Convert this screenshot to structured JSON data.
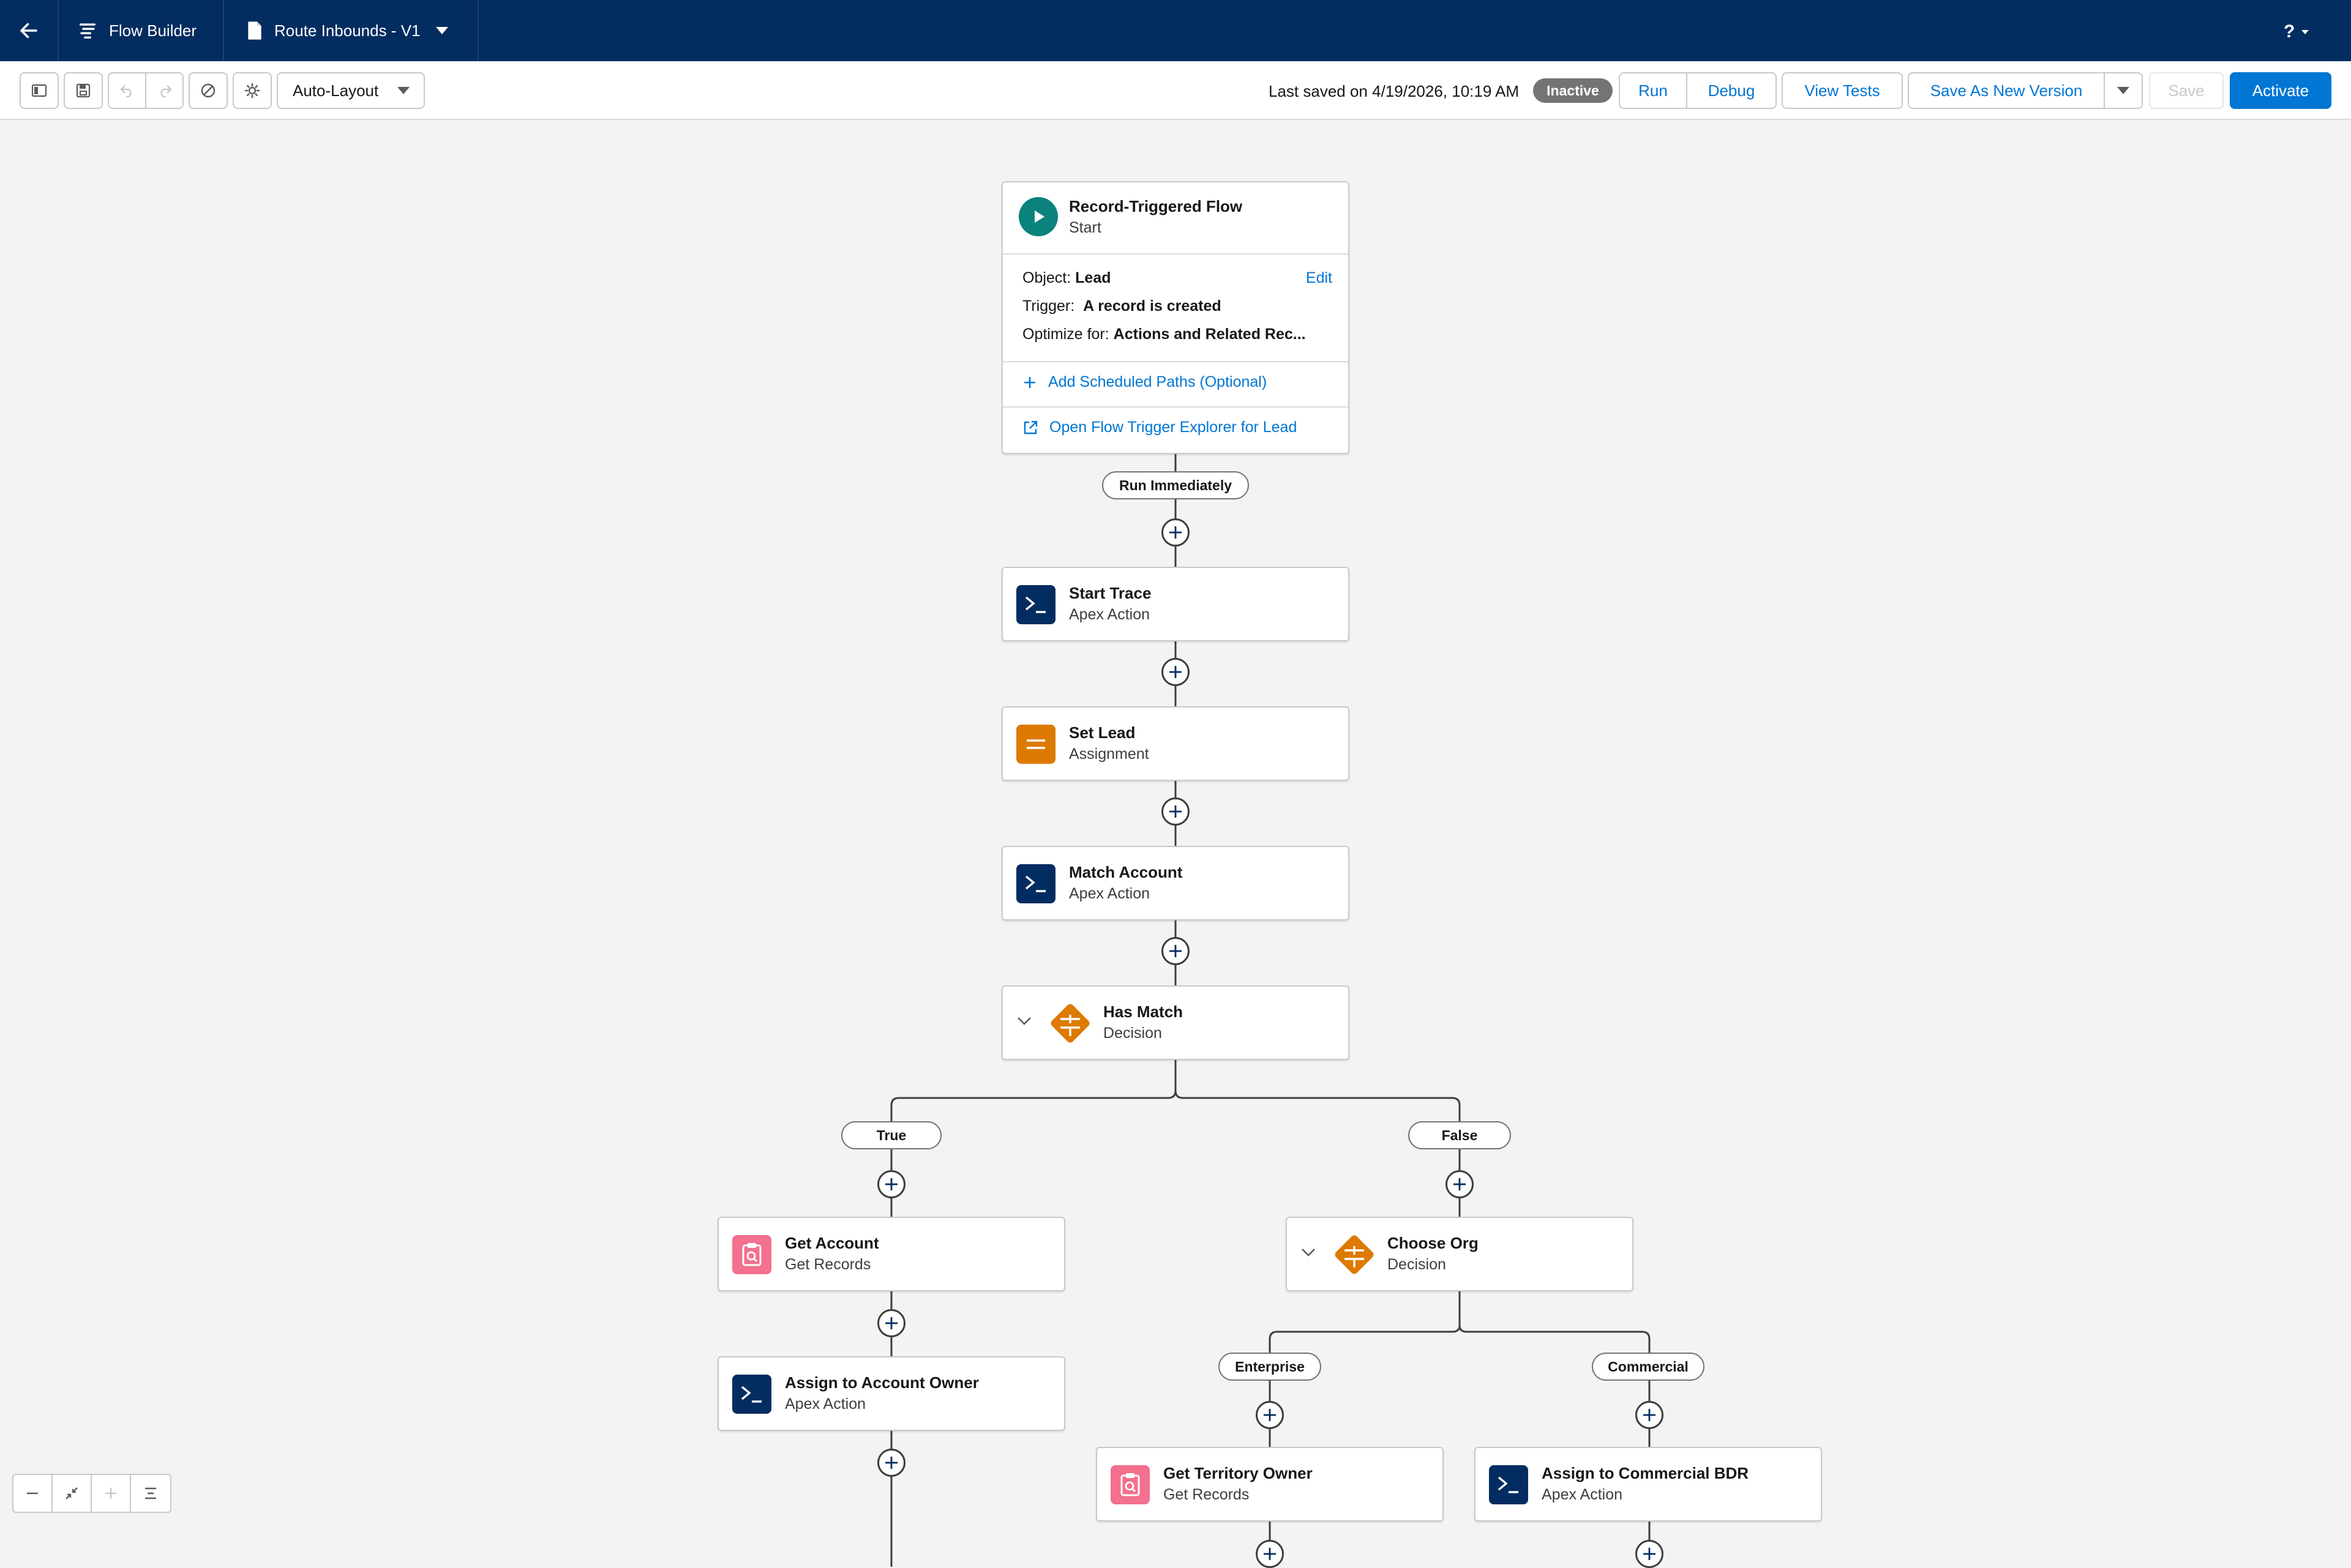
{
  "topnav": {
    "app_name": "Flow Builder",
    "flow_name": "Route Inbounds - V1",
    "help": "?"
  },
  "toolbar": {
    "layout_select": "Auto-Layout",
    "last_saved": "Last saved on 4/19/2026, 10:19 AM",
    "status_badge": "Inactive",
    "run": "Run",
    "debug": "Debug",
    "view_tests": "View Tests",
    "save_as_new_version": "Save As New Version",
    "save": "Save",
    "activate": "Activate"
  },
  "start_node": {
    "title": "Record-Triggered Flow",
    "subtitle": "Start",
    "object_label": "Object:",
    "object_value": "Lead",
    "edit": "Edit",
    "trigger_label": "Trigger:",
    "trigger_value": "A record is created",
    "optimize_label": "Optimize for:",
    "optimize_value": "Actions and Related Rec...",
    "add_scheduled_paths": "Add Scheduled Paths (Optional)",
    "open_trigger_explorer": "Open Flow Trigger Explorer for Lead"
  },
  "path_labels": {
    "run_immediately": "Run Immediately",
    "true": "True",
    "false": "False",
    "enterprise": "Enterprise",
    "commercial": "Commercial"
  },
  "nodes": {
    "start_trace": {
      "title": "Start Trace",
      "type": "Apex Action"
    },
    "set_lead": {
      "title": "Set Lead",
      "type": "Assignment"
    },
    "match_account": {
      "title": "Match Account",
      "type": "Apex Action"
    },
    "has_match": {
      "title": "Has Match",
      "type": "Decision"
    },
    "get_account": {
      "title": "Get Account",
      "type": "Get Records"
    },
    "assign_account_owner": {
      "title": "Assign to Account Owner",
      "type": "Apex Action"
    },
    "choose_org": {
      "title": "Choose Org",
      "type": "Decision"
    },
    "get_territory_owner": {
      "title": "Get Territory Owner",
      "type": "Get Records"
    },
    "assign_commercial_bdr": {
      "title": "Assign to Commercial BDR",
      "type": "Apex Action"
    }
  },
  "colors": {
    "nav_bg": "#032d60",
    "brand_blue": "#0176d3",
    "apex_icon": "#032d60",
    "assignment_icon": "#dd7a01",
    "decision_icon": "#dd7a01",
    "get_records_icon": "#f3708e",
    "start_icon": "#0b827c",
    "inactive_badge": "#747474"
  }
}
